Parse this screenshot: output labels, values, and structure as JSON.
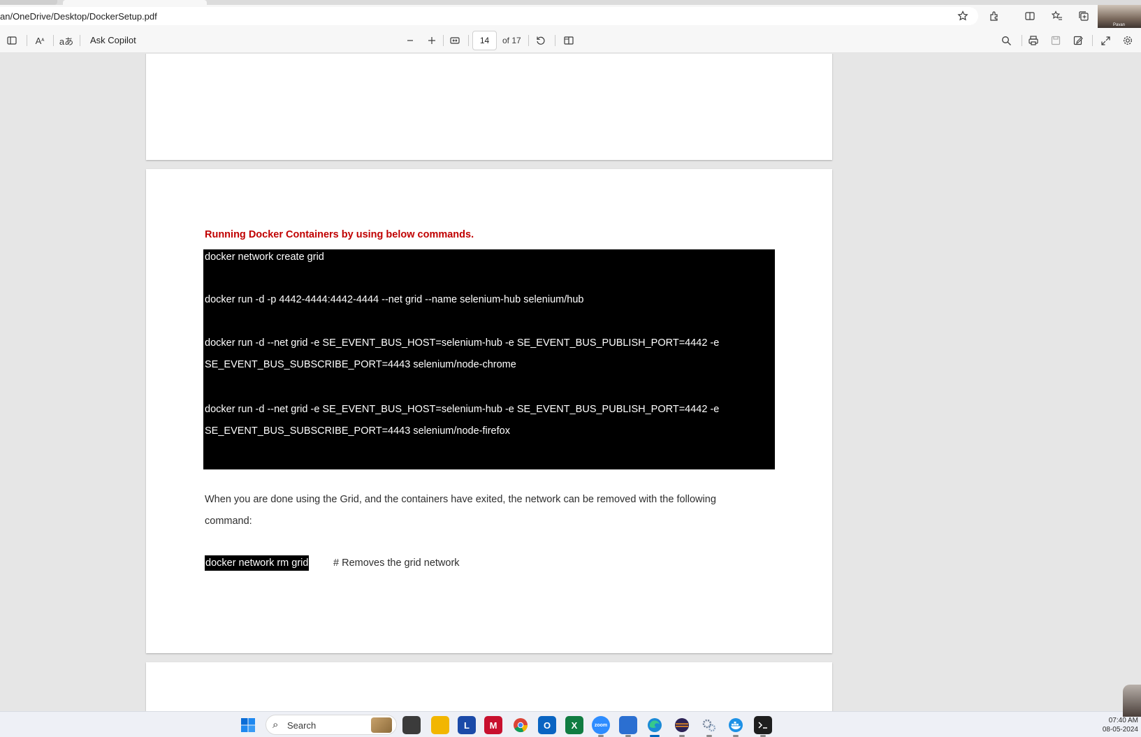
{
  "browser": {
    "address": "an/OneDrive/Desktop/DockerSetup.pdf",
    "profile_name": "Pavan",
    "address_icons": [
      "star-icon",
      "extensions-icon",
      "split-screen-icon",
      "favorites-icon",
      "collections-icon"
    ]
  },
  "pdf_toolbar": {
    "ask_copilot": "Ask Copilot",
    "page_current": "14",
    "page_total": "of 17",
    "left_icons": [
      "contents-icon",
      "read-aloud-icon",
      "translate-icon"
    ],
    "center_icons": [
      "zoom-out-icon",
      "zoom-in-icon",
      "fit-page-icon",
      "rotate-icon",
      "page-view-icon"
    ],
    "right_icons": [
      "search-icon",
      "print-icon",
      "save-icon",
      "save-as-icon",
      "fullscreen-icon",
      "settings-icon"
    ]
  },
  "document": {
    "heading": "Running Docker Containers by using below commands.",
    "code_lines": [
      "docker network create grid",
      "docker run -d -p 4442-4444:4442-4444 --net grid --name selenium-hub selenium/hub",
      "docker run -d --net grid -e SE_EVENT_BUS_HOST=selenium-hub -e SE_EVENT_BUS_PUBLISH_PORT=4442 -e",
      "SE_EVENT_BUS_SUBSCRIBE_PORT=4443 selenium/node-chrome",
      "docker run -d --net grid -e SE_EVENT_BUS_HOST=selenium-hub -e SE_EVENT_BUS_PUBLISH_PORT=4442 -e",
      "SE_EVENT_BUS_SUBSCRIBE_PORT=4443 selenium/node-firefox"
    ],
    "paragraph_line1": "When you are done using the Grid, and the containers have exited, the network can be removed with the following",
    "paragraph_line2": "command:",
    "remove_command": "docker network rm grid",
    "remove_comment": "# Removes the grid network"
  },
  "taskbar": {
    "search_label": "Search",
    "time": "07:40 AM",
    "date": "08-05-2024",
    "app_icons": [
      "start-icon",
      "task-view-icon",
      "file-explorer-icon",
      "l-app-icon",
      "mcafee-icon",
      "chrome-icon",
      "outlook-icon",
      "excel-icon",
      "zoom-icon",
      "notepad-icon",
      "edge-icon",
      "eclipse-icon",
      "settings-gears-icon",
      "docker-icon",
      "terminal-icon"
    ]
  },
  "colors": {
    "heading_red": "#c00000",
    "code_bg": "#000000",
    "active_indicator": "#0067c0"
  }
}
